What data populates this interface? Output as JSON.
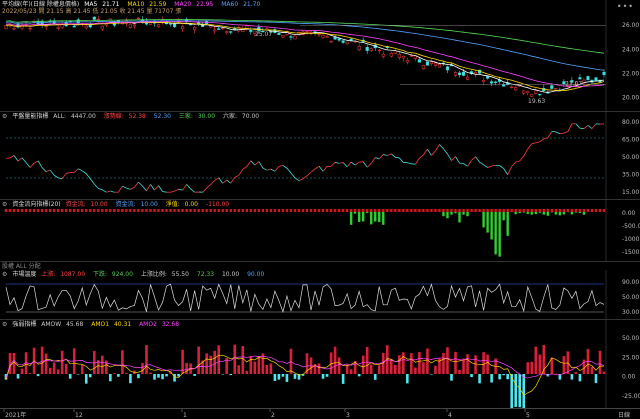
{
  "panels": {
    "main": {
      "title": "平均線(年)(日線 除權息價格)",
      "ma": [
        {
          "label": "MA5",
          "value": "21.71",
          "color": "#ffffff"
        },
        {
          "label": "MA10",
          "value": "21.59",
          "color": "#ffd700"
        },
        {
          "label": "MA20",
          "value": "22.95",
          "color": "#ff44ff"
        },
        {
          "label": "MA60",
          "value": "21.70",
          "color": "#4fa3ff"
        }
      ],
      "ohlc_line": "2022/05/23 開 21.15 高 21.45 低 21.05 收 21.45 量 71707 張",
      "axis": [
        "26.00",
        "24.00",
        "22.00",
        "20.00"
      ],
      "notes": [
        "25.07",
        "21.07",
        "19.63"
      ]
    },
    "kd": {
      "title": "平盤量能指標",
      "stats": [
        {
          "label": "ALL:",
          "value": "4447.00",
          "color": "#cccccc"
        },
        {
          "label": "漲勢線:",
          "value": "52.38",
          "color": "#ff4444"
        },
        {
          "label": "",
          "value": "52.30",
          "color": "#4fa3ff"
        },
        {
          "label": "三家:",
          "value": "30.00",
          "color": "#55cc55"
        },
        {
          "label": "六家:",
          "value": "70.00",
          "color": "#cccccc"
        }
      ],
      "axis": [
        "80.00",
        "65.00",
        "50.00",
        "35.00",
        "15.00"
      ]
    },
    "flow": {
      "title": "資金流向指標(20)",
      "stats": [
        {
          "label": "資金流:",
          "value": "10.00",
          "color": "#ff4444"
        },
        {
          "label": "資金流:",
          "value": "10.00",
          "color": "#4fa3ff"
        },
        {
          "label": "淨值:",
          "value": "0.00",
          "color": "#ffd700"
        },
        {
          "label": "",
          "value": "-110.00",
          "color": "#ff4444"
        }
      ],
      "axis": [
        "0.00",
        "-500.0",
        "-1000",
        "-1500"
      ]
    },
    "note": {
      "label": "股權 ALL 分配"
    },
    "market": {
      "title": "市場溫度",
      "stats": [
        {
          "label": "上漲:",
          "value": "1087.00",
          "color": "#ff4444"
        },
        {
          "label": "下跌:",
          "value": "924.00",
          "color": "#55cc55"
        },
        {
          "label": "上漲比例:",
          "value": "55.50",
          "color": "#cccccc"
        },
        {
          "label": "",
          "value": "72.33",
          "color": "#55cc55"
        },
        {
          "label": "",
          "value": "10.00",
          "color": "#cccccc"
        },
        {
          "label": "",
          "value": "90.00",
          "color": "#4fa3ff"
        }
      ],
      "axis": [
        "90.00",
        "50.00",
        "30.00"
      ]
    },
    "amo": {
      "title": "強弱指標",
      "stats": [
        {
          "label": "AMOW",
          "value": "45.68",
          "color": "#cccccc"
        },
        {
          "label": "AMO1",
          "value": "40.31",
          "color": "#ffd700"
        },
        {
          "label": "AMO2",
          "value": "32.68",
          "color": "#ff44ff"
        }
      ],
      "axis": [
        "50.00",
        "25.00",
        "0.00",
        "-25.00"
      ]
    }
  },
  "time_axis": {
    "labels": [
      "2021年",
      "12",
      "1",
      "2",
      "3",
      "4",
      "5"
    ],
    "corner": "日線"
  }
}
